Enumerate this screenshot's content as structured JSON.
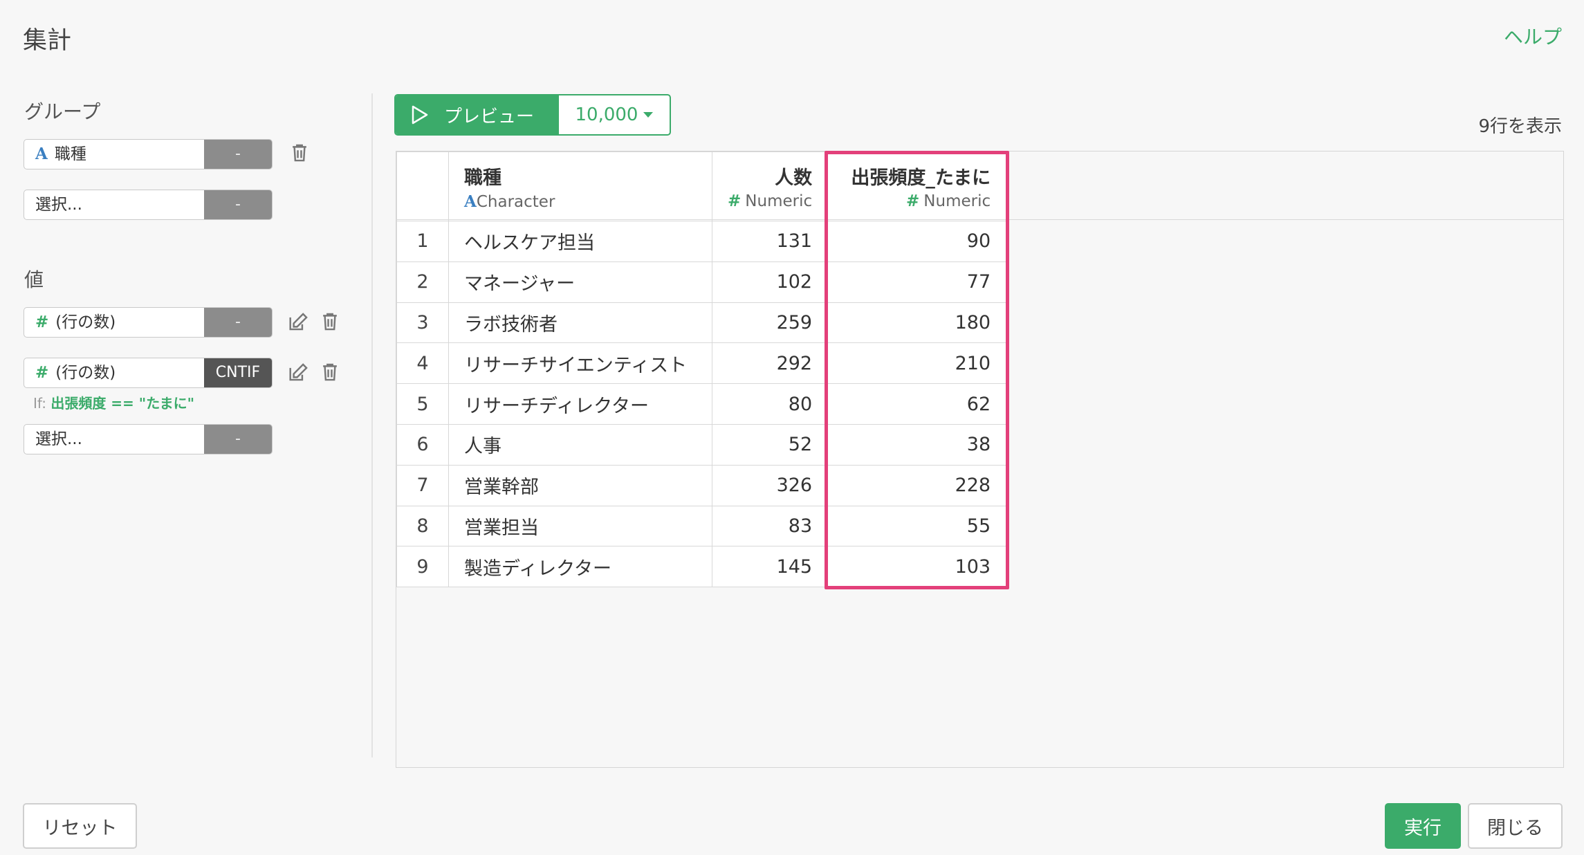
{
  "dialog": {
    "title": "集計",
    "help_label": "ヘルプ"
  },
  "group_section": {
    "label": "グループ",
    "fields": [
      {
        "icon": "A",
        "type": "character",
        "name": "職種",
        "button": "-"
      },
      {
        "icon": "",
        "type": "empty",
        "name": "選択...",
        "button": "-"
      }
    ]
  },
  "value_section": {
    "label": "値",
    "fields": [
      {
        "icon": "#",
        "type": "numeric",
        "name": "(行の数)",
        "button": "-"
      },
      {
        "icon": "#",
        "type": "numeric",
        "name": "(行の数)",
        "button": "CNTIF"
      },
      {
        "icon": "",
        "type": "empty",
        "name": "選択...",
        "button": "-"
      }
    ],
    "condition": {
      "prefix": "If:",
      "expression": "出張頻度 == \"たまに\""
    }
  },
  "toolbar": {
    "preview_label": "プレビュー",
    "rows_value": "10,000",
    "row_count_text": "9行を表示"
  },
  "table": {
    "columns": [
      {
        "name": "職種",
        "type_icon": "A",
        "type_label": "Character"
      },
      {
        "name": "人数",
        "type_icon": "#",
        "type_label": "Numeric"
      },
      {
        "name": "出張頻度_たまに",
        "type_icon": "#",
        "type_label": "Numeric"
      }
    ],
    "rows": [
      {
        "idx": "1",
        "job": "ヘルスケア担当",
        "count": "131",
        "freq": "90"
      },
      {
        "idx": "2",
        "job": "マネージャー",
        "count": "102",
        "freq": "77"
      },
      {
        "idx": "3",
        "job": "ラボ技術者",
        "count": "259",
        "freq": "180"
      },
      {
        "idx": "4",
        "job": "リサーチサイエンティスト",
        "count": "292",
        "freq": "210"
      },
      {
        "idx": "5",
        "job": "リサーチディレクター",
        "count": "80",
        "freq": "62"
      },
      {
        "idx": "6",
        "job": "人事",
        "count": "52",
        "freq": "38"
      },
      {
        "idx": "7",
        "job": "営業幹部",
        "count": "326",
        "freq": "228"
      },
      {
        "idx": "8",
        "job": "営業担当",
        "count": "83",
        "freq": "55"
      },
      {
        "idx": "9",
        "job": "製造ディレクター",
        "count": "145",
        "freq": "103"
      }
    ]
  },
  "footer": {
    "reset_label": "リセット",
    "run_label": "実行",
    "close_label": "閉じる"
  },
  "colors": {
    "accent": "#3bab6a",
    "highlight": "#e3407a",
    "character_icon": "#3a7fc1"
  }
}
